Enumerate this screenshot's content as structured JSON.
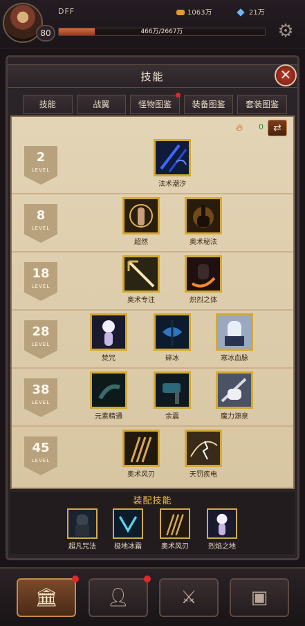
{
  "player": {
    "name": "DFF",
    "level": "80",
    "gold": "1063万",
    "gems": "21万",
    "exp_text": "466万/2667万",
    "exp_fraction": 0.175
  },
  "panel": {
    "title": "技能"
  },
  "tabs": [
    {
      "label": "技能",
      "active": true,
      "dot": false
    },
    {
      "label": "战翼",
      "active": false,
      "dot": false
    },
    {
      "label": "怪物图鉴",
      "active": false,
      "dot": true
    },
    {
      "label": "装备图鉴",
      "active": false,
      "dot": false
    },
    {
      "label": "套装图鉴",
      "active": false,
      "dot": false
    }
  ],
  "tree": {
    "currency_value": "0",
    "level_word": "LEVEL",
    "rows": [
      {
        "level": "2",
        "skills": [
          "法术潮汐"
        ]
      },
      {
        "level": "8",
        "skills": [
          "超然",
          "奥术秘法"
        ]
      },
      {
        "level": "18",
        "skills": [
          "奥术专注",
          "炽烈之体"
        ]
      },
      {
        "level": "28",
        "skills": [
          "焚咒",
          "碎冰",
          "寒冰血脉"
        ]
      },
      {
        "level": "38",
        "skills": [
          "元素精通",
          "余震",
          "魔力源泉"
        ]
      },
      {
        "level": "45",
        "skills": [
          "奥术风刃",
          "天罚疾电"
        ]
      }
    ]
  },
  "equip": {
    "title": "装配技能",
    "slots": [
      "超凡咒法",
      "极地冰霜",
      "奥术风刃",
      "烈焰之地"
    ]
  },
  "nav": [
    {
      "icon": "bank-icon",
      "active": true,
      "dot": true
    },
    {
      "icon": "character-icon",
      "active": false,
      "dot": true
    },
    {
      "icon": "crossed-swords-icon",
      "active": false,
      "dot": false
    },
    {
      "icon": "treasure-chest-icon",
      "active": false,
      "dot": false
    }
  ]
}
